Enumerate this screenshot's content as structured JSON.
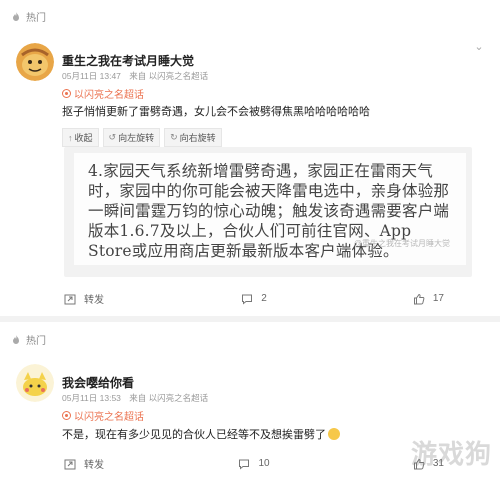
{
  "posts": [
    {
      "hot_label": "热门",
      "username": "重生之我在考试月睡大觉",
      "date": "05月11日 13:47",
      "source": "来自 以闪亮之名超话",
      "topic_tag": "以闪亮之名超话",
      "text": "抠子悄悄更新了雷劈奇遇，女儿会不会被劈得焦黑哈哈哈哈哈哈",
      "toolbar": {
        "collapse": "收起",
        "rotate_left": "向左旋转",
        "rotate_right": "向右旋转"
      },
      "image_text": "4.家园天气系统新增雷劈奇遇，家园正在雷雨天气时，家园中的你可能会被天降雷电选中，亲身体验那一瞬间雷霆万钧的惊心动魄；触发该奇遇需要客户端版本1.6.7及以上，合伙人们可前往官网、App Store或应用商店更新最新版本客户端体验。",
      "image_watermark": "@重生之我在考试月睡大觉",
      "repost_label": "转发",
      "comments": "2",
      "likes": "17"
    },
    {
      "hot_label": "热门",
      "username": "我会嘤给你看",
      "date": "05月11日 13:53",
      "source": "来自 以闪亮之名超话",
      "topic_tag": "以闪亮之名超话",
      "text": "不是，现在有多少见见的合伙人已经等不及想挨雷劈了",
      "repost_label": "转发",
      "comments": "10",
      "likes": "31"
    }
  ],
  "site_watermark": "游戏狗",
  "colors": {
    "accent": "#eb7350",
    "background": "#f2f2f2"
  }
}
